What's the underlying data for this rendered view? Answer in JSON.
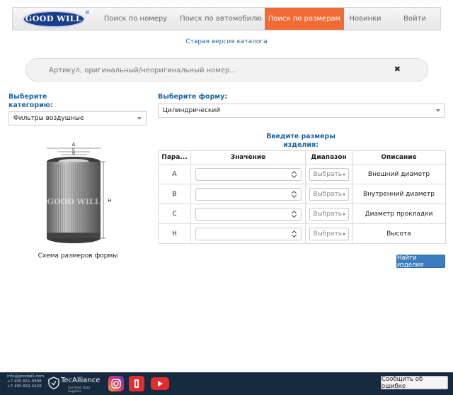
{
  "logo": {
    "text": "GOOD WILL",
    "reg": "®"
  },
  "nav": {
    "tabs": [
      {
        "label": "Поиск по номеру"
      },
      {
        "label": "Поиск по автомобилю"
      },
      {
        "label": "Поиск по размерам",
        "active": true
      },
      {
        "label": "Новинки"
      }
    ],
    "login": "Войти"
  },
  "old_version_link": "Старая версия каталога",
  "search": {
    "placeholder": "Артикул, оригинальный/неоригинальный номер...",
    "value": "",
    "clear_icon": "close-icon"
  },
  "category": {
    "label_line1": "Выберите",
    "label_line2": "категорию:",
    "selected": "Фильтры воздушные"
  },
  "shape": {
    "label": "Выберите форму:",
    "selected": "Цилиндрический"
  },
  "diagram": {
    "caption": "Схема размеров формы",
    "labels": {
      "a": "A",
      "b": "B",
      "c": "C",
      "h": "H"
    },
    "brand": "GOOD WILL"
  },
  "dimensions": {
    "title_line1": "Введите размеры",
    "title_line2": "изделия:",
    "headers": [
      "Пара...",
      "Значение",
      "Диапазон",
      "Описание"
    ],
    "rows": [
      {
        "param": "A",
        "value": "",
        "range": "Выбрать",
        "description": "Внешний диаметр"
      },
      {
        "param": "B",
        "value": "",
        "range": "Выбрать",
        "description": "Внутренний диаметр"
      },
      {
        "param": "C",
        "value": "",
        "range": "Выбрать",
        "description": "Диаметр прокладки"
      },
      {
        "param": "H",
        "value": "",
        "range": "Выбрать",
        "description": "Высота"
      }
    ]
  },
  "find_button": "Найти изделия",
  "footer": {
    "email": "info@goodwill.com",
    "phone1": "+7 495 651-0998",
    "phone2": "+7 495 662-4429",
    "tecalliance_name": "TecAlliance",
    "tecalliance_sub": "Certified Data Supplier",
    "social": [
      "instagram-icon",
      "dzen-icon",
      "youtube-icon"
    ],
    "report_button": "Сообщить об ошибке"
  },
  "colors": {
    "accent": "#f26a36",
    "link": "#1d66a6",
    "button": "#3a7dc1",
    "footer": "#162b3f"
  }
}
